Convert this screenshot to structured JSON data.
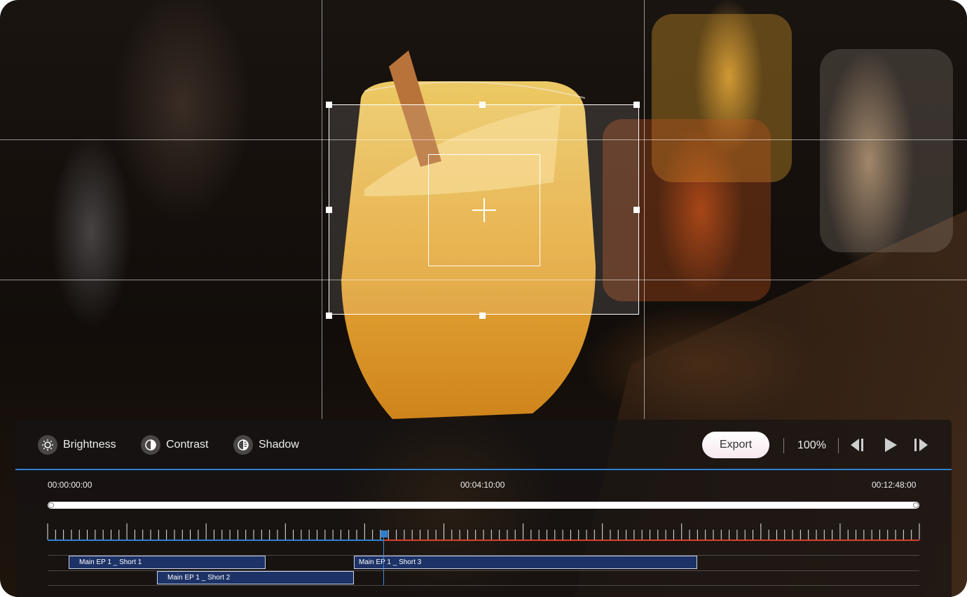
{
  "toolbar": {
    "tools": [
      {
        "label": "Brightness",
        "icon": "brightness-icon"
      },
      {
        "label": "Contrast",
        "icon": "contrast-icon"
      },
      {
        "label": "Shadow",
        "icon": "shadow-icon"
      }
    ],
    "export_label": "Export",
    "zoom_level": "100%",
    "playback_icons": [
      "skip-back-icon",
      "play-icon",
      "skip-forward-icon"
    ]
  },
  "timeline": {
    "timecodes": {
      "start": "00:00:00:00",
      "middle": "00:04:10:00",
      "end": "00:12:48:00"
    },
    "playhead_fraction": 0.386,
    "clips": [
      {
        "label": "Main EP 1 _ Short 1",
        "track": 1
      },
      {
        "label": "Main EP 1 _ Short 2",
        "track": 2
      },
      {
        "label": "Main EP 1 _ Short 3",
        "track": 1
      }
    ]
  },
  "colors": {
    "accent_blue": "#2f7ecf",
    "ruler_progress_red": "#d8402e",
    "clip_fill": "#1d3266"
  }
}
